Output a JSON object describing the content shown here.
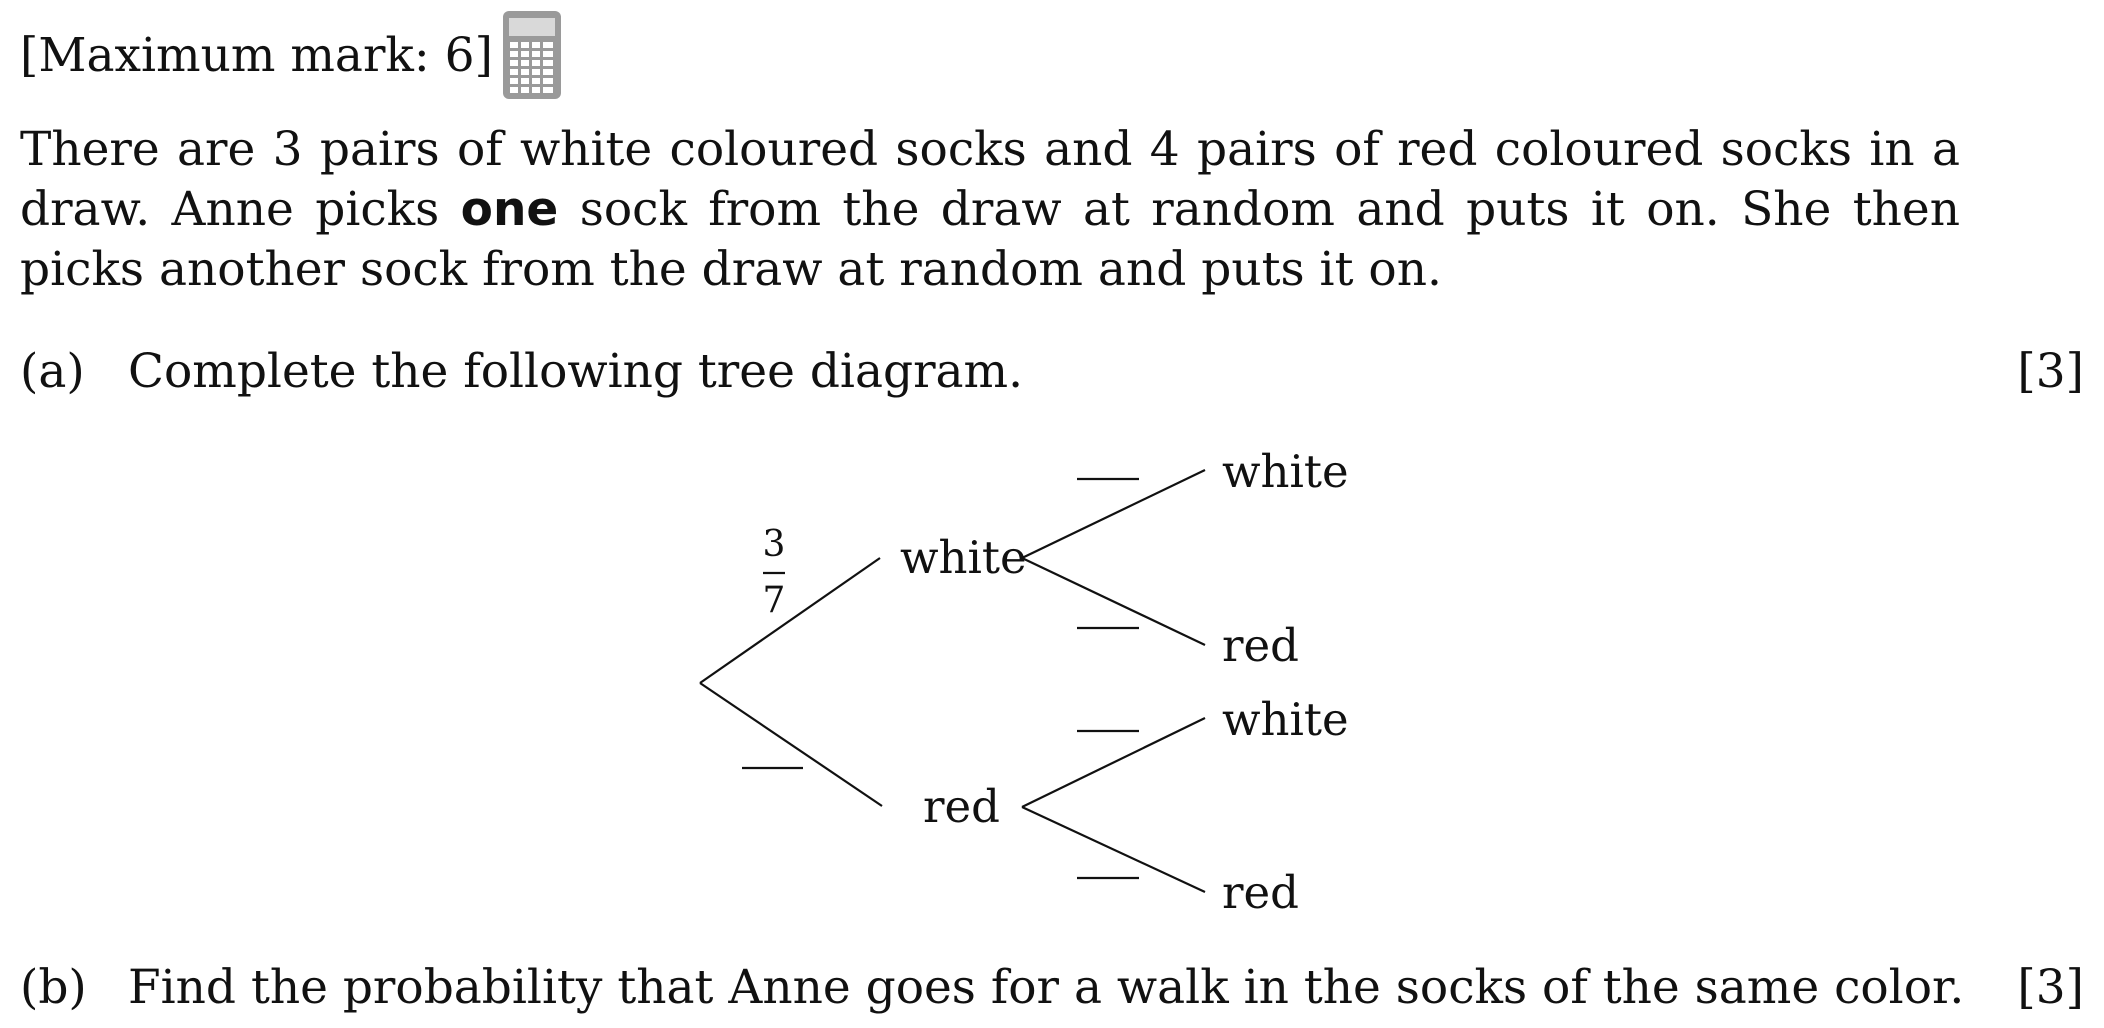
{
  "header": {
    "max_mark": "[Maximum mark: 6]",
    "calculator_icon": "calculator-icon"
  },
  "intro": {
    "part1": "There are 3 pairs of white coloured socks and 4 pairs of red coloured socks in a draw. Anne picks ",
    "bold": "one",
    "part2": " sock from the draw at random and puts it on. She then picks another sock from the draw at random and puts it on."
  },
  "part_a": {
    "label": "(a)",
    "text": "Complete the following tree diagram.",
    "marks": "[3]"
  },
  "tree": {
    "first_white_prob_num": "3",
    "first_white_prob_den": "7",
    "first_white": "white",
    "first_red": "red",
    "second_white_white": "white",
    "second_white_red": "red",
    "second_red_white": "white",
    "second_red_red": "red"
  },
  "part_b": {
    "label": "(b)",
    "text": "Find the probability that Anne goes for a walk in the socks of the same color.",
    "marks": "[3]"
  }
}
